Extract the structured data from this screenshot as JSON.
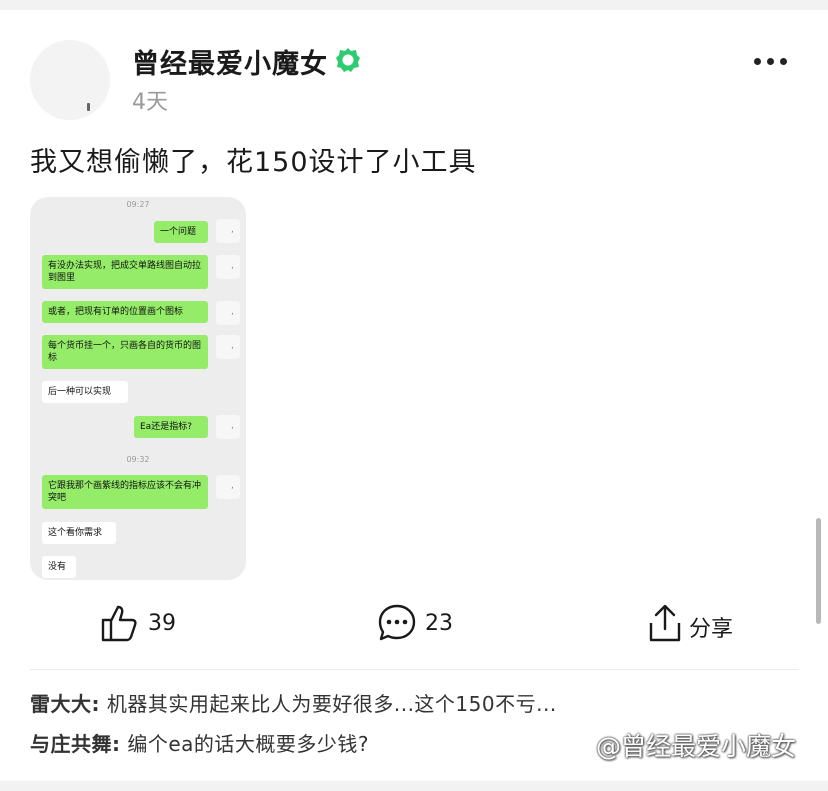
{
  "post": {
    "username": "曾经最爱小魔女",
    "time": "4天",
    "text": "我又想偷懒了，花150设计了小工具"
  },
  "chat": {
    "times": [
      "09:27",
      "09:32"
    ],
    "messages": [
      {
        "side": "right",
        "text": "一个问题"
      },
      {
        "side": "right",
        "text": "有没办法实现，把成交单路线图自动拉到图里"
      },
      {
        "side": "right",
        "text": "或者，把现有订单的位置画个图标"
      },
      {
        "side": "right",
        "text": "每个货币挂一个，只画各自的货币的图标"
      },
      {
        "side": "left",
        "text": "后一种可以实现"
      },
      {
        "side": "right",
        "text": "Ea还是指标?"
      },
      {
        "side": "right",
        "text": "它跟我那个画紫线的指标应该不会有冲突吧"
      },
      {
        "side": "left",
        "text": "这个看你需求"
      },
      {
        "side": "left",
        "text": "没有"
      }
    ]
  },
  "actions": {
    "like_count": "39",
    "comment_count": "23",
    "share_label": "分享"
  },
  "comments": [
    {
      "author": "雷大大",
      "sep": ":",
      "text": " 机器其实用起来比人为要好很多...这个150不亏..."
    },
    {
      "author": "与庄共舞",
      "sep": ":",
      "text": " 编个ea的话大概要多少钱?"
    }
  ],
  "watermark": "@曾经最爱小魔女",
  "colors": {
    "bubble_green": "#95ec69",
    "verified_green": "#2ecc71",
    "muted_text": "#9a9a9a"
  },
  "icons": [
    "verified-icon",
    "more-icon",
    "like-icon",
    "comment-icon",
    "share-icon",
    "brand-icon"
  ]
}
